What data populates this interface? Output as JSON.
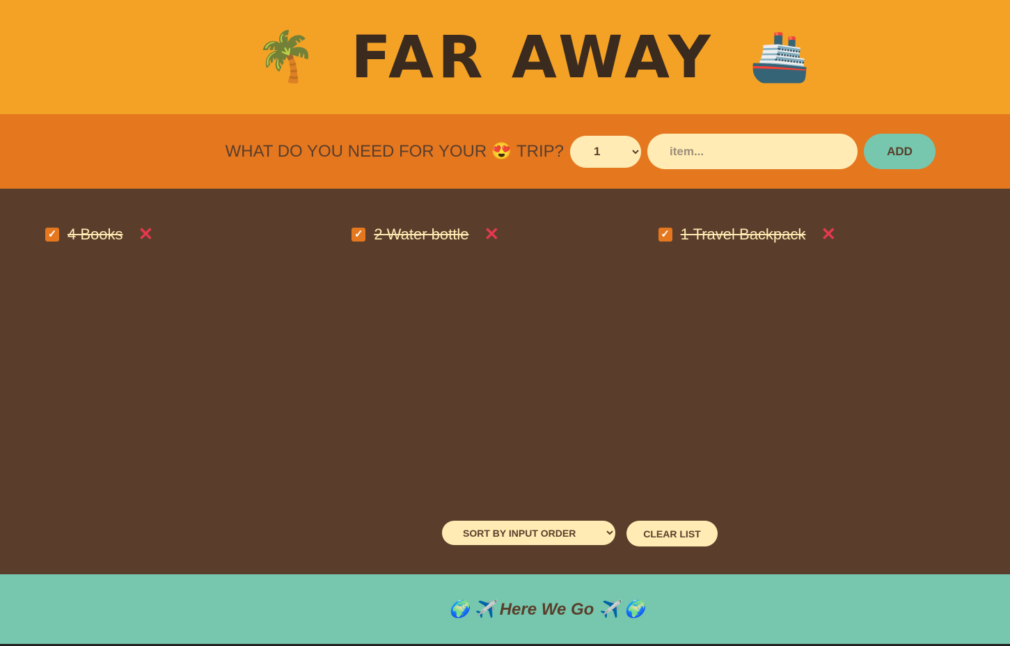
{
  "header": {
    "title": "FAR AWAY",
    "left_emoji": "🌴",
    "right_emoji": "🚢"
  },
  "form": {
    "question": "WHAT DO YOU NEED FOR YOUR 😍 TRIP?",
    "quantity": "1",
    "item_placeholder": "item...",
    "item_value": "",
    "add_label": "ADD"
  },
  "items": [
    {
      "quantity": "4",
      "name": "Books",
      "text": "4 Books",
      "packed": true
    },
    {
      "quantity": "2",
      "name": "Water bottle",
      "text": "2 Water bottle",
      "packed": true
    },
    {
      "quantity": "1",
      "name": "Travel Backpack",
      "text": "1 Travel Backpack",
      "packed": true
    }
  ],
  "actions": {
    "sort_selected": "SORT BY INPUT ORDER",
    "clear_label": "CLEAR LIST"
  },
  "footer": {
    "text": "🌍 ✈️ Here We Go ✈️ 🌍"
  },
  "colors": {
    "header": "#f4a226",
    "form": "#e5771f",
    "list": "#5a3e2b",
    "footer": "#76c7ad",
    "delete": "#e5384f"
  }
}
